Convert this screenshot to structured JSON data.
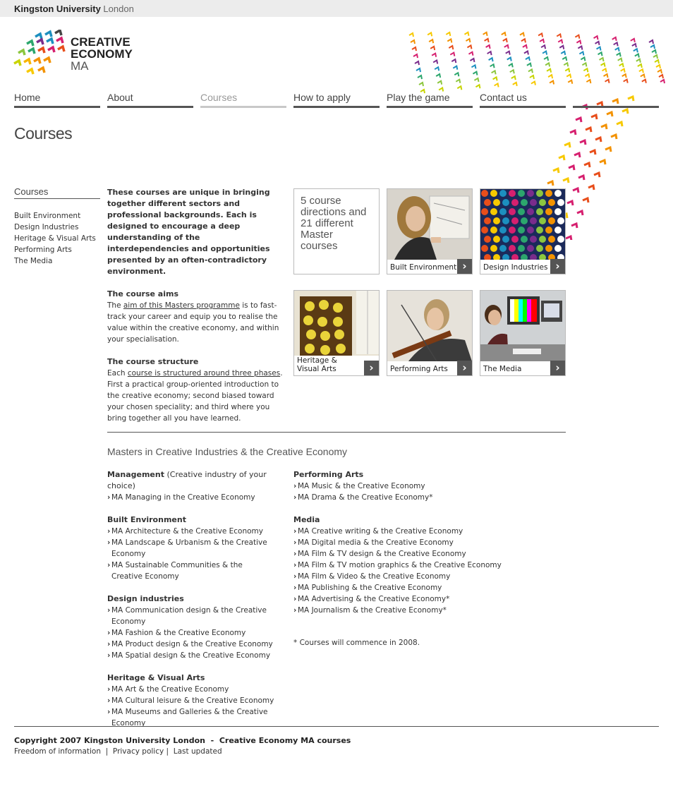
{
  "header": {
    "university_bold": "Kingston University",
    "university_light": "London",
    "logo_line1": "CREATIVE",
    "logo_line2": "ECONOMY",
    "logo_line3": "MA"
  },
  "nav": [
    {
      "label": "Home"
    },
    {
      "label": "About"
    },
    {
      "label": "Courses"
    },
    {
      "label": "How to apply"
    },
    {
      "label": "Play the game"
    },
    {
      "label": "Contact us"
    }
  ],
  "page_title": "Courses",
  "subnav": {
    "heading": "Courses",
    "items": [
      "Built Environment",
      "Design Industries",
      "Heritage & Visual Arts",
      "Performing Arts",
      "The Media"
    ]
  },
  "intro": {
    "lead": "These courses are unique in bringing together different sectors and professional backgrounds. Each is designed to encourage a deep understanding of the interdependencies and opportunities presented by an often-contradictory environment.",
    "aims_heading": "The course aims",
    "aims_pre": "The ",
    "aims_link": "aim of this Masters programme",
    "aims_post": " is to fast-track your career and equip you to realise the value within the creative economy, and within your specialisation.",
    "structure_heading": "The course structure",
    "structure_pre": "Each ",
    "structure_link": "course is structured around three phases",
    "structure_post": ". First a practical group-oriented introduction to the creative economy; second biased toward your chosen speciality; and third where you bring together all you have learned."
  },
  "tiles": {
    "promo": "5 course directions and 21 different Master courses",
    "items": [
      {
        "label": "Built Environment"
      },
      {
        "label": "Design Industries"
      },
      {
        "label": "Heritage & Visual Arts"
      },
      {
        "label": "Performing Arts"
      },
      {
        "label": "The Media"
      }
    ],
    "arrow": "›"
  },
  "masters": {
    "title": "Masters in Creative Industries & the Creative Economy",
    "left": [
      {
        "heading": "Management",
        "heading_note": " (Creative industry of your choice)",
        "items": [
          "MA Managing in the Creative Economy"
        ]
      },
      {
        "heading": "Built Environment",
        "items": [
          "MA Architecture & the Creative Economy",
          "MA Landscape & Urbanism & the Creative Economy",
          "MA Sustainable Communities & the Creative Economy"
        ]
      },
      {
        "heading": "Design industries",
        "items": [
          "MA Communication design & the Creative Economy",
          "MA Fashion & the Creative Economy",
          "MA Product design & the Creative Economy",
          "MA Spatial design & the Creative Economy"
        ]
      },
      {
        "heading": "Heritage & Visual Arts",
        "items": [
          "MA Art & the Creative Economy",
          "MA Cultural leisure & the Creative Economy",
          "MA Museums and Galleries & the Creative Economy"
        ]
      }
    ],
    "right": [
      {
        "heading": "Performing Arts",
        "items": [
          "MA Music & the Creative Economy",
          "MA Drama & the Creative Economy*"
        ]
      },
      {
        "heading": "Media",
        "items": [
          "MA Creative writing & the Creative Economy",
          "MA Digital media & the Creative Economy",
          "MA Film & TV design & the Creative Economy",
          "MA Film & TV motion graphics & the Creative Economy",
          "MA Film & Video & the Creative Economy",
          "MA Publishing & the Creative Economy",
          "MA Advertising & the Creative Economy*",
          "MA Journalism & the Creative Economy*"
        ]
      }
    ],
    "note": "* Courses will commence in 2008."
  },
  "footer": {
    "copyright": "Copyright 2007 Kingston University London  -  Creative Economy MA courses",
    "links": [
      "Freedom of information",
      "Privacy policy",
      "Last updated"
    ],
    "separator": "|"
  }
}
